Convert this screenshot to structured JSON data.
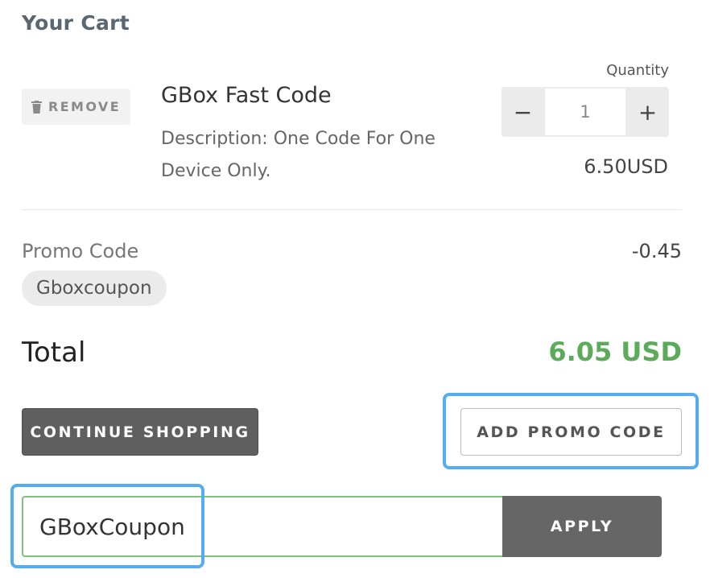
{
  "cart": {
    "title": "Your Cart",
    "remove_label": "REMOVE",
    "item": {
      "name": "GBox Fast Code",
      "description": "Description: One Code For One Device Only.",
      "quantity_label": "Quantity",
      "quantity": "1",
      "minus": "−",
      "plus": "+",
      "price": "6.50",
      "currency": "USD"
    },
    "promo": {
      "label": "Promo Code",
      "code": "Gboxcoupon",
      "discount": "-0.45"
    },
    "total": {
      "label": "Total",
      "amount": "6.05 USD",
      "amount_color": "#5cab5a"
    },
    "buttons": {
      "continue_shopping": "CONTINUE SHOPPING",
      "add_promo_code": "ADD PROMO CODE",
      "apply": "APPLY"
    },
    "coupon_input": {
      "value": "GBoxCoupon"
    },
    "highlight_color": "#55acee",
    "icons": {
      "remove": "trash-icon"
    }
  }
}
